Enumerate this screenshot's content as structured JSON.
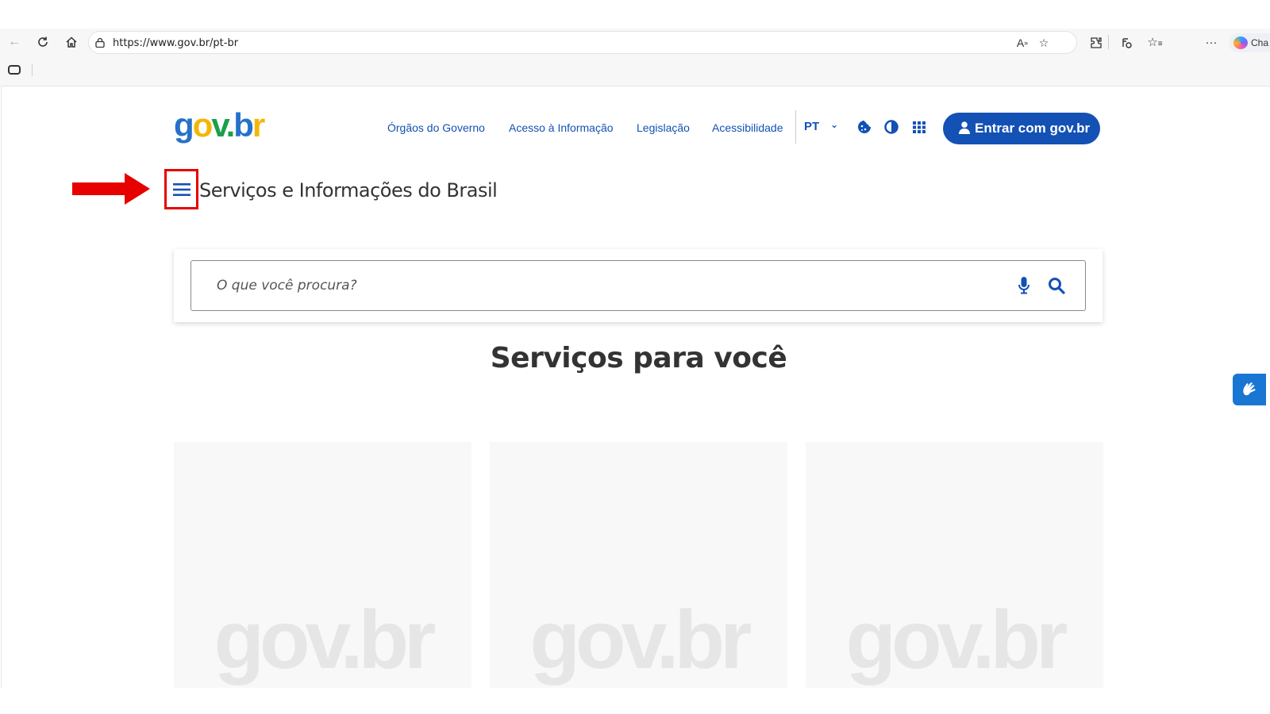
{
  "browser": {
    "url": "https://www.gov.br/pt-br",
    "copilot_label": "Cha"
  },
  "header": {
    "logo_text": [
      "g",
      "o",
      "v",
      ".",
      "b",
      "r"
    ],
    "links": [
      "Órgãos do Governo",
      "Acesso à Informação",
      "Legislação",
      "Acessibilidade"
    ],
    "language": "PT",
    "login_label": "Entrar com gov.br"
  },
  "site_title": "Serviços e Informações do Brasil",
  "search": {
    "placeholder": "O que você procura?"
  },
  "section_title": "Serviços para você",
  "cards": [
    {
      "watermark": "gov.br"
    },
    {
      "watermark": "gov.br"
    },
    {
      "watermark": "gov.br"
    }
  ],
  "colors": {
    "brand_blue": "#1351b4",
    "annotation_red": "#e60000",
    "card_bg": "#f8f8f8"
  },
  "icons": {
    "menu": "hamburger-icon",
    "search": "search-icon",
    "mic": "microphone-icon",
    "cookie": "cookie-icon",
    "contrast": "contrast-icon",
    "apps": "apps-grid-icon",
    "user": "user-icon",
    "vlibras": "sign-language-icon"
  }
}
